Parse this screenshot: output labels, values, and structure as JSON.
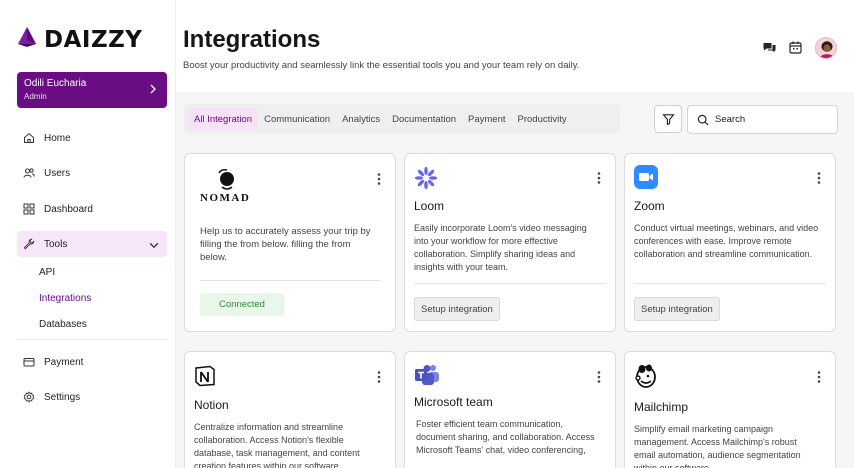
{
  "brand": {
    "name": "DAIZZY",
    "accent": "#6a0d83"
  },
  "user": {
    "name": "Odili Eucharia",
    "role": "Admin"
  },
  "nav": {
    "home": "Home",
    "users": "Users",
    "dashboard": "Dashboard",
    "tools": "Tools",
    "tools_sub": {
      "api": "API",
      "integrations": "Integrations",
      "databases": "Databases"
    },
    "payment": "Payment",
    "settings": "Settings"
  },
  "header": {
    "title": "Integrations",
    "subtitle": "Boost your productivity and seamlessly link the essential tools you and your team rely on daily."
  },
  "tabs": [
    "All Integration",
    "Communication",
    "Analytics",
    "Documentation",
    "Payment",
    "Productivity"
  ],
  "search": {
    "placeholder": "Search"
  },
  "cards": [
    {
      "logo_text": "NOMAD",
      "title": "",
      "desc": "Help us to accurately assess your trip by filling the from below. filling the from below.",
      "status": "Connected"
    },
    {
      "title": "Loom",
      "desc": "Easily incorporate Loom's video messaging into your workflow for more effective collaboration. Simplify sharing ideas and insights with your team.",
      "action": "Setup integration"
    },
    {
      "title": "Zoom",
      "desc": "Conduct virtual meetings, webinars, and video conferences with ease. Improve remote collaboration and streamline communication.",
      "action": "Setup integration"
    },
    {
      "title": "Notion",
      "desc": "Centralize information and streamline collaboration. Access Notion's flexible database, task management, and content creation features within our software."
    },
    {
      "title": "Microsoft team",
      "desc": "Foster efficient team communication, document sharing, and collaboration. Access Microsoft Teams' chat, video conferencing,"
    },
    {
      "title": "Mailchimp",
      "desc": "Simplify email marketing campaign management. Access Mailchimp's robust email automation, audience segmentation within our software."
    }
  ],
  "icons": {
    "brand": "triangle-logo-icon",
    "chevron": "chevron-right-icon",
    "home": "home-icon",
    "users": "users-icon",
    "dashboard": "grid-icon",
    "tools": "wrench-icon",
    "payment": "card-icon",
    "settings": "gear-icon",
    "chat": "chat-icon",
    "calendar": "calendar-icon",
    "filter": "filter-icon",
    "search": "search-icon",
    "more": "more-vertical-icon"
  }
}
